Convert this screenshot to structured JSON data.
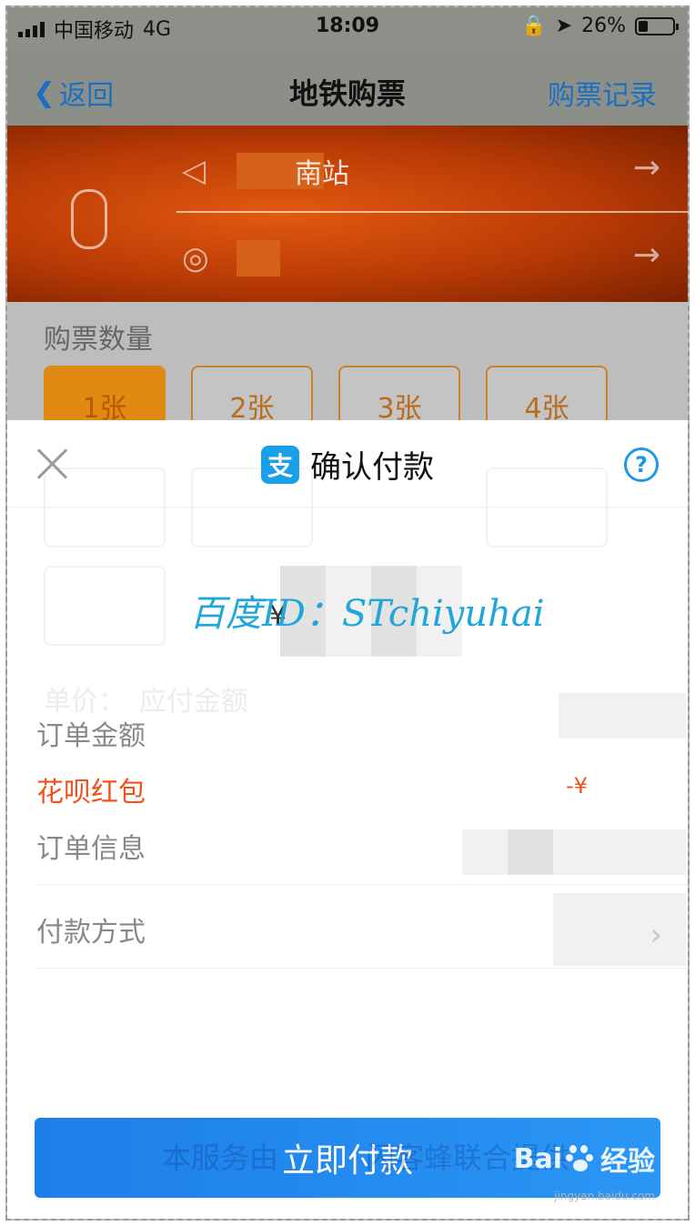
{
  "status_bar": {
    "carrier": "中国移动",
    "network": "4G",
    "time": "18:09",
    "battery_percent": "26%",
    "battery_level": 0.26
  },
  "nav": {
    "back_label": "返回",
    "title": "地铁购票",
    "history_label": "购票记录"
  },
  "route": {
    "from_suffix": "南站"
  },
  "quantity": {
    "label": "购票数量",
    "options": [
      "1张",
      "2张",
      "3张",
      "4张"
    ],
    "selected": "1张"
  },
  "sheet": {
    "title": "确认付款",
    "help_symbol": "?",
    "alipay_glyph": "支",
    "watermark": "百度ID：STchiyuhai",
    "currency_symbol": "¥",
    "order_amount_label": "订单金额",
    "huabei_label": "花呗红包",
    "huabei_value": "-¥",
    "order_info_label": "订单信息",
    "payment_method_label": "付款方式",
    "pay_button_label": "立即付款"
  },
  "background_ghost": {
    "unit_price": "单价：",
    "should_pay": "应付金额",
    "service_note": "本服务由",
    "service_note_tail": "闪客蜂联合提供"
  },
  "brand": {
    "baidu": "Bai",
    "jingyan": "经验",
    "url": "jingyan.baidu.com"
  },
  "colors": {
    "accent_blue": "#1a6fc4",
    "route_orange": "#c84a08",
    "ticket_orange": "#e08a14",
    "alipay_blue": "#1aa0e8",
    "warning_red": "#f4501e",
    "pay_button": "#1d7fe8"
  }
}
